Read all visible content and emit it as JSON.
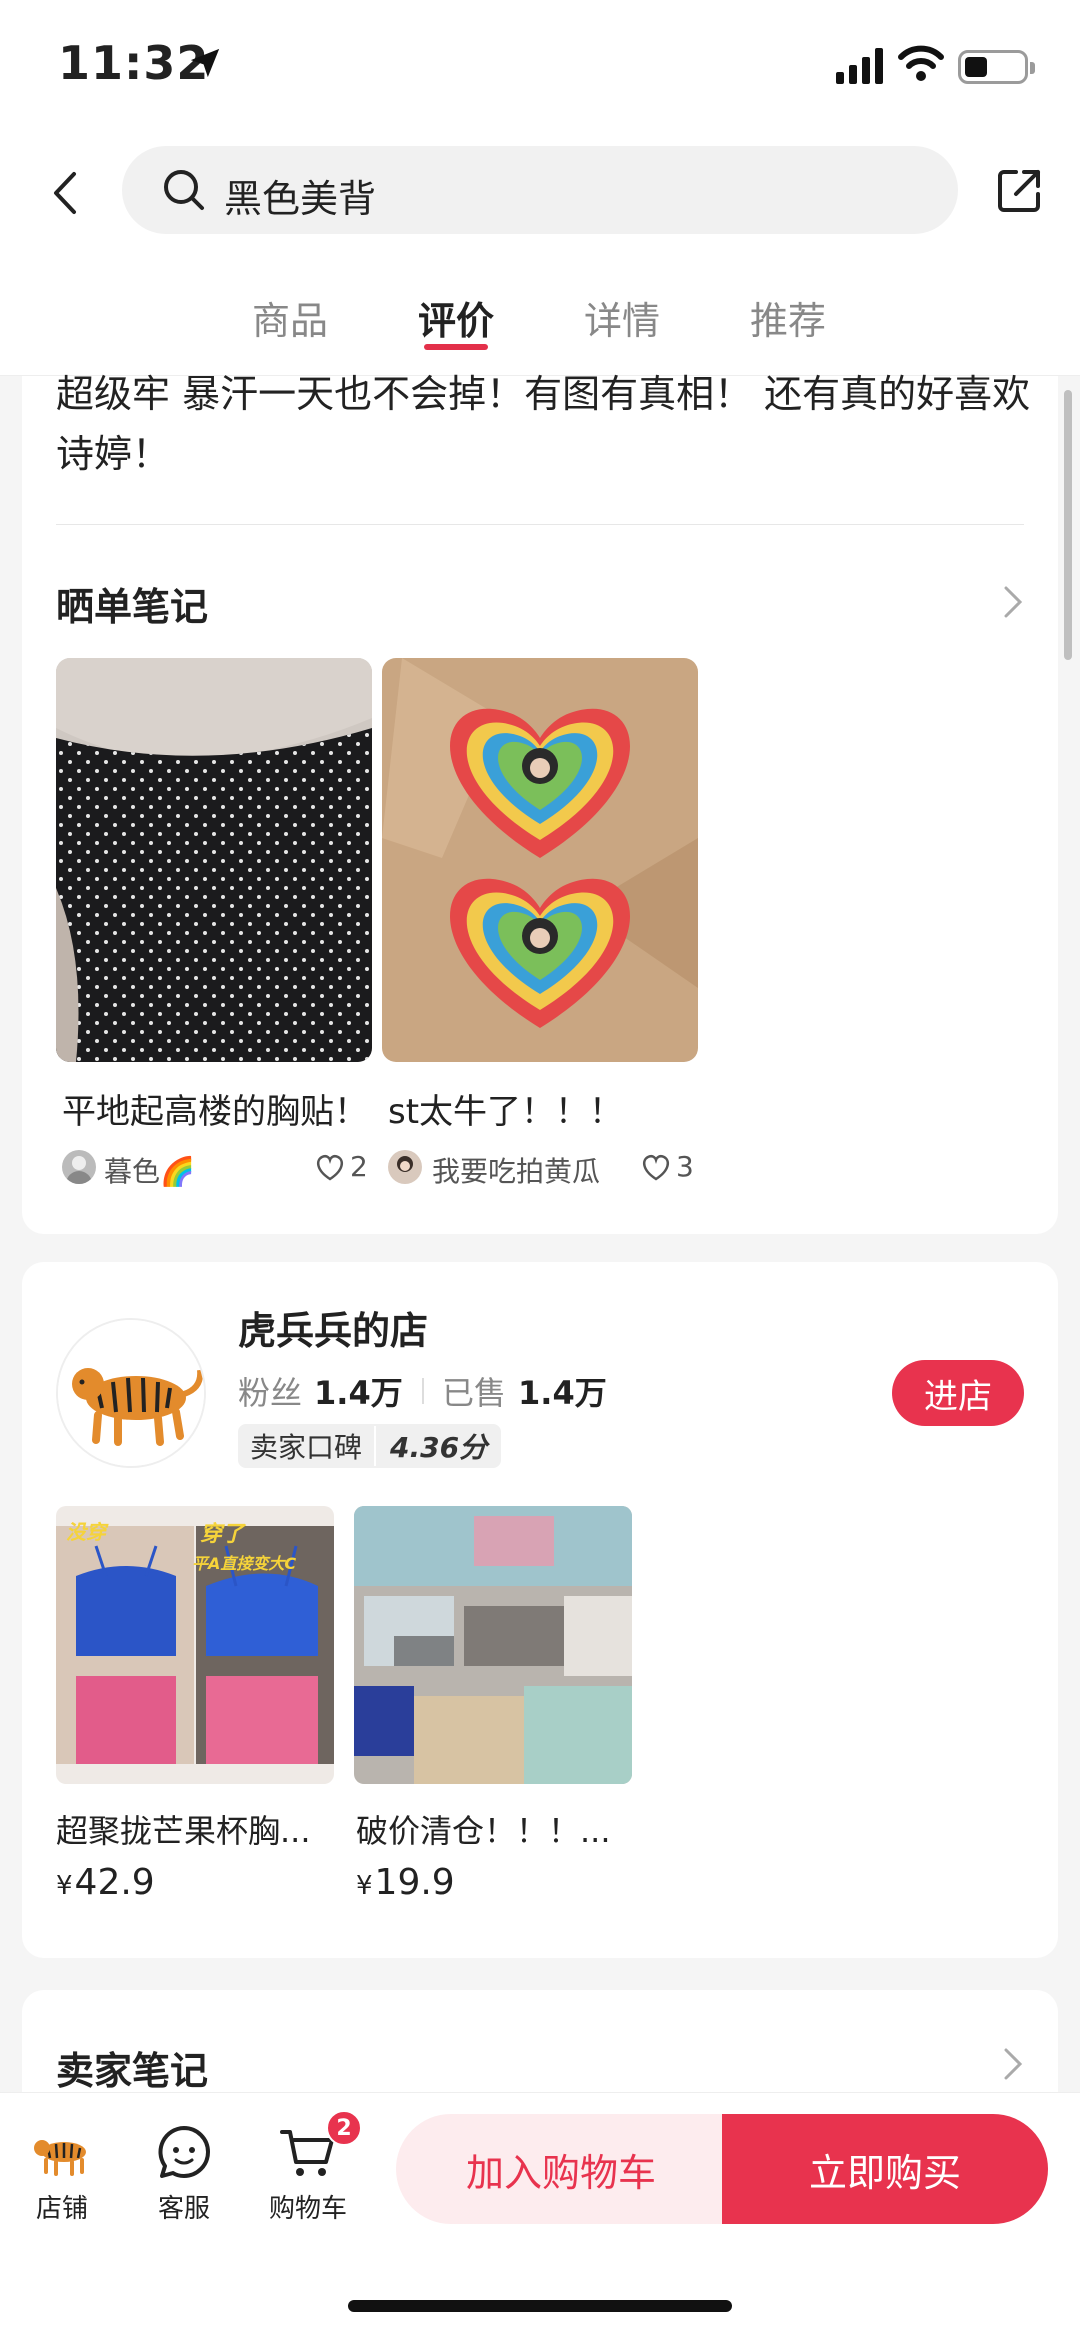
{
  "status_bar": {
    "time": "11:32"
  },
  "header": {
    "search_text": "黑色美背",
    "tabs": [
      {
        "label": "商品",
        "active": false
      },
      {
        "label": "评价",
        "active": true
      },
      {
        "label": "详情",
        "active": false
      },
      {
        "label": "推荐",
        "active": false
      }
    ]
  },
  "review": {
    "text": "超级牢 暴汗一天也不会掉！有图有真相！ 还有真的好喜欢诗婷！"
  },
  "notes": {
    "title": "晒单笔记",
    "items": [
      {
        "title": "平地起高楼的胸贴！",
        "user": "暮色🌈",
        "likes": "2"
      },
      {
        "title": "st太牛了！！！",
        "user": "我要吃拍黄瓜",
        "likes": "3"
      }
    ]
  },
  "store": {
    "name": "虎兵兵的店",
    "fans_label": "粉丝",
    "fans_value": "1.4万",
    "sold_label": "已售",
    "sold_value": "1.4万",
    "rating_label": "卖家口碑",
    "rating_value": "4.36分",
    "enter_label": "进店",
    "products": [
      {
        "name": "超聚拢芒果杯胸...",
        "price_symbol": "¥",
        "price": "42.9",
        "overlay_left": "没穿",
        "overlay_right": "穿了",
        "overlay_sub": "平A直接变大C"
      },
      {
        "name": "破价清仓！！！...",
        "price_symbol": "¥",
        "price": "19.9"
      }
    ]
  },
  "seller_notes": {
    "title": "卖家笔记"
  },
  "bottom_bar": {
    "store_label": "店铺",
    "service_label": "客服",
    "cart_label": "购物车",
    "cart_count": "2",
    "add_cart_label": "加入购物车",
    "buy_now_label": "立即购买"
  },
  "colors": {
    "accent": "#e8334e",
    "tab_underline": "#e3304a"
  }
}
